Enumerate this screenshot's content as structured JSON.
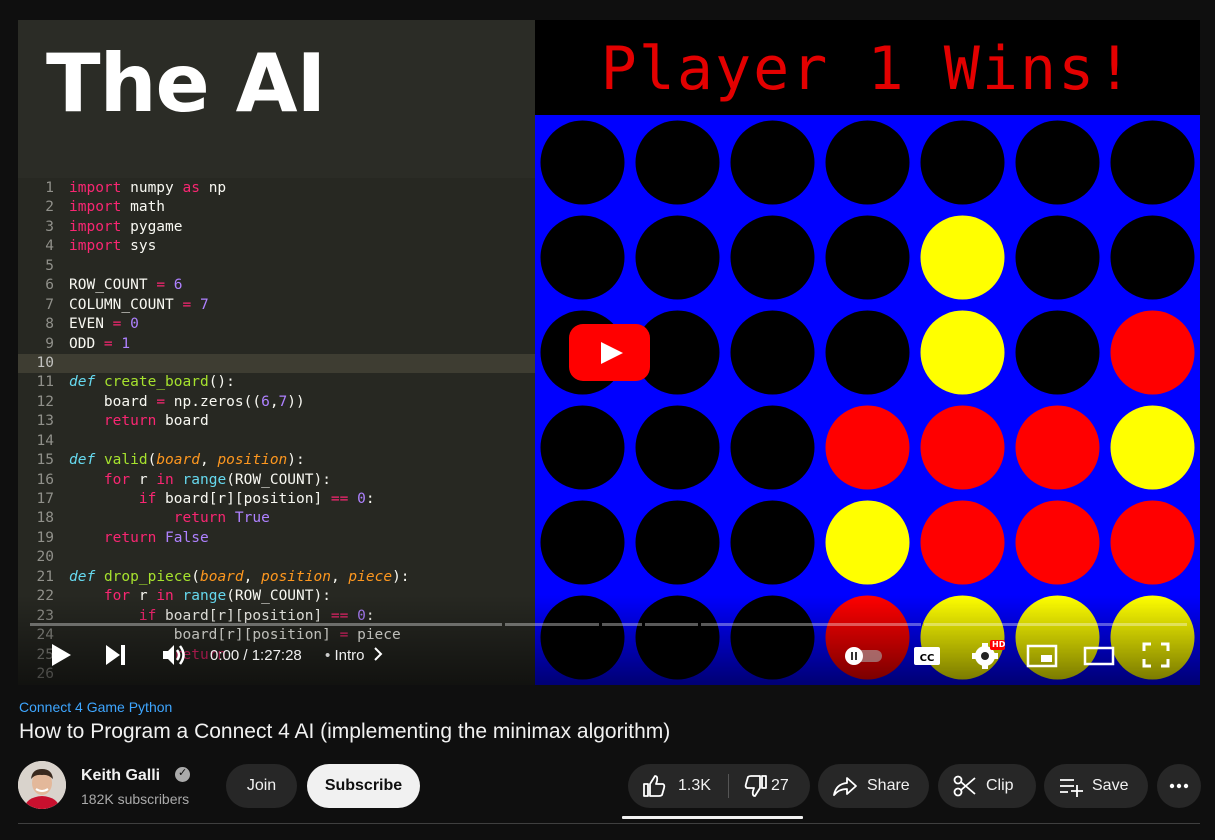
{
  "player": {
    "video_text": "The AI",
    "code_lines": [
      {
        "n": "1",
        "html": "<span class=\"kw\">import</span> numpy <span class=\"kw\">as</span> np"
      },
      {
        "n": "2",
        "html": "<span class=\"kw\">import</span> math"
      },
      {
        "n": "3",
        "html": "<span class=\"kw\">import</span> pygame"
      },
      {
        "n": "4",
        "html": "<span class=\"kw\">import</span> sys"
      },
      {
        "n": "5",
        "html": ""
      },
      {
        "n": "6",
        "html": "ROW_COUNT <span class=\"op\">=</span> <span class=\"num\">6</span>"
      },
      {
        "n": "7",
        "html": "COLUMN_COUNT <span class=\"op\">=</span> <span class=\"num\">7</span>"
      },
      {
        "n": "8",
        "html": "EVEN <span class=\"op\">=</span> <span class=\"num\">0</span>"
      },
      {
        "n": "9",
        "html": "ODD <span class=\"op\">=</span> <span class=\"num\">1</span>"
      },
      {
        "n": "10",
        "html": "",
        "active": true
      },
      {
        "n": "11",
        "html": "<span class=\"def\">def</span> <span class=\"fn\">create_board</span>():"
      },
      {
        "n": "12",
        "html": "    board <span class=\"op\">=</span> np.zeros((<span class=\"num\">6</span>,<span class=\"num\">7</span>))"
      },
      {
        "n": "13",
        "html": "    <span class=\"kw\">return</span> board"
      },
      {
        "n": "14",
        "html": ""
      },
      {
        "n": "15",
        "html": "<span class=\"def\">def</span> <span class=\"fn\">valid</span>(<span class=\"param\">board</span>, <span class=\"param\">position</span>):"
      },
      {
        "n": "16",
        "html": "    <span class=\"kw\">for</span> r <span class=\"kw\">in</span> <span class=\"bi\">range</span>(ROW_COUNT):"
      },
      {
        "n": "17",
        "html": "        <span class=\"kw\">if</span> board[r][position] <span class=\"op\">==</span> <span class=\"num\">0</span>:"
      },
      {
        "n": "18",
        "html": "            <span class=\"kw\">return</span> <span class=\"cst\">True</span>"
      },
      {
        "n": "19",
        "html": "    <span class=\"kw\">return</span> <span class=\"cst\">False</span>"
      },
      {
        "n": "20",
        "html": ""
      },
      {
        "n": "21",
        "html": "<span class=\"def\">def</span> <span class=\"fn\">drop_piece</span>(<span class=\"param\">board</span>, <span class=\"param\">position</span>, <span class=\"param\">piece</span>):"
      },
      {
        "n": "22",
        "html": "    <span class=\"kw\">for</span> r <span class=\"kw\">in</span> <span class=\"bi\">range</span>(ROW_COUNT):"
      },
      {
        "n": "23",
        "html": "        <span class=\"kw\">if</span> board[r][position] <span class=\"op\">==</span> <span class=\"num\">0</span>:"
      },
      {
        "n": "24",
        "html": "            board[r][position] <span class=\"op\">=</span> piece"
      },
      {
        "n": "25",
        "html": "            <span class=\"kw\">return</span>"
      },
      {
        "n": "26",
        "html": ""
      }
    ],
    "game_status": "Player 1 Wins!",
    "board_colors": {
      "background": "#0000ff",
      "empty": "#000000",
      "player1": "#ff0000",
      "player2": "#ffff00"
    },
    "board": [
      [
        "empty",
        "empty",
        "empty",
        "empty",
        "empty",
        "empty",
        "empty"
      ],
      [
        "empty",
        "empty",
        "empty",
        "empty",
        "player2",
        "empty",
        "empty"
      ],
      [
        "empty",
        "empty",
        "empty",
        "empty",
        "player2",
        "empty",
        "player1"
      ],
      [
        "empty",
        "empty",
        "empty",
        "player1",
        "player1",
        "player1",
        "player2"
      ],
      [
        "empty",
        "empty",
        "empty",
        "player2",
        "player1",
        "player1",
        "player1"
      ],
      [
        "empty",
        "empty",
        "empty",
        "player1",
        "player2",
        "player2",
        "player2"
      ]
    ],
    "time_current": "0:00",
    "time_separator": " / ",
    "time_total": "1:27:28",
    "chapter": "Intro",
    "hd_badge": "HD"
  },
  "video": {
    "playlist": "Connect 4 Game Python",
    "title": "How to Program a Connect 4 AI (implementing the minimax algorithm)"
  },
  "channel": {
    "name": "Keith Galli",
    "subscribers": "182K subscribers"
  },
  "actions": {
    "join": "Join",
    "subscribe": "Subscribe",
    "likes": "1.3K",
    "dislikes": "27",
    "share": "Share",
    "clip": "Clip",
    "save": "Save"
  }
}
